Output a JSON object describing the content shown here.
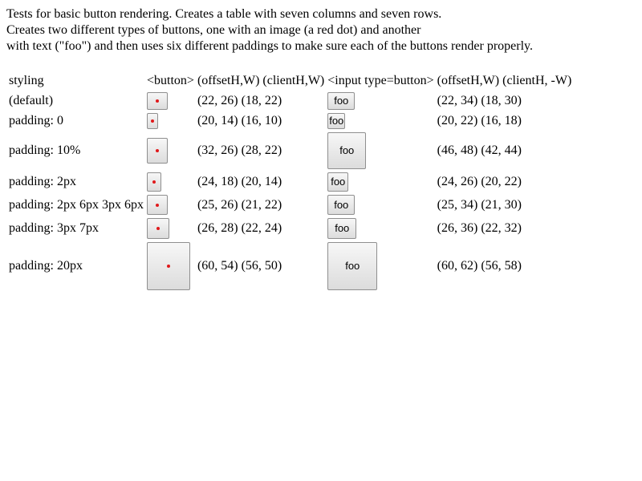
{
  "intro": {
    "line1": "Tests for basic button rendering. Creates a table with seven columns and seven rows.",
    "line2": "Creates two different types of buttons, one with an image (a red dot) and another",
    "line3": "with text (\"foo\") and then uses six different paddings to make sure each of the buttons render properly."
  },
  "table": {
    "headers": {
      "styling": "styling",
      "button": "<button>",
      "button_dims": "(offsetH,W) (clientH,W)",
      "input_button": "<input type=button>",
      "input_dims": "(offsetH,W) (clientH, -W)"
    },
    "input_text": "foo",
    "colors": {
      "dot": "#e0191b",
      "button_border": "#8f8f8f"
    },
    "rows": [
      {
        "styling": "(default)",
        "button_dims": "(22, 26) (18, 22)",
        "input_dims": "(22, 34) (18, 30)"
      },
      {
        "styling": "padding: 0",
        "button_dims": "(20, 14) (16, 10)",
        "input_dims": "(20, 22) (16, 18)"
      },
      {
        "styling": "padding: 10%",
        "button_dims": "(32, 26) (28, 22)",
        "input_dims": "(46, 48) (42, 44)"
      },
      {
        "styling": "padding: 2px",
        "button_dims": "(24, 18) (20, 14)",
        "input_dims": "(24, 26) (20, 22)"
      },
      {
        "styling": "padding: 2px 6px 3px 6px",
        "button_dims": "(25, 26) (21, 22)",
        "input_dims": "(25, 34) (21, 30)"
      },
      {
        "styling": "padding: 3px 7px",
        "button_dims": "(26, 28) (22, 24)",
        "input_dims": "(26, 36) (22, 32)"
      },
      {
        "styling": "padding: 20px",
        "button_dims": "(60, 54) (56, 50)",
        "input_dims": "(60, 62) (56, 58)"
      }
    ]
  }
}
